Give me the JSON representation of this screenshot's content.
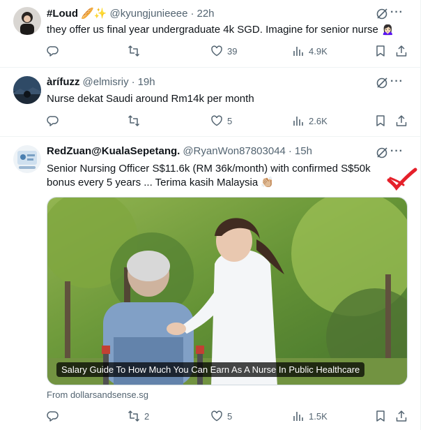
{
  "colors": {
    "text": "#0f1419",
    "secondary": "#536471",
    "border": "#eff3f4",
    "accent_mark": "#e5202a"
  },
  "tweets": [
    {
      "display_name": "#Loud 🥖✨",
      "handle": "@kyungjunieeee",
      "time": "22h",
      "text": "they offer us final year undergraduate 4k SGD. Imagine for senior nurse 🙍🏻‍♀️",
      "replies": "",
      "reposts": "",
      "likes": "39",
      "views": "4.9K"
    },
    {
      "display_name": "àrífuzz",
      "handle": "@elmisriy",
      "time": "19h",
      "text": "Nurse dekat Saudi around Rm14k per month",
      "replies": "",
      "reposts": "",
      "likes": "5",
      "views": "2.6K"
    },
    {
      "display_name": "RedZuan@KualaSepetang.",
      "handle": "@RyanWon87803044",
      "time": "15h",
      "text": "Senior Nursing Officer S$11.6k (RM 36k/month) with confirmed S$50k bonus every 5 years ... Terima kasih Malaysia 👏🏼",
      "card_caption": "Salary Guide To How Much You Can Earn As A Nurse In Public Healthcare",
      "card_source": "From dollarsandsense.sg",
      "replies": "",
      "reposts": "2",
      "likes": "5",
      "views": "1.5K"
    }
  ],
  "icons": {
    "reply": "reply-icon",
    "repost": "repost-icon",
    "like": "heart-icon",
    "views": "views-icon",
    "bookmark": "bookmark-icon",
    "share": "share-icon",
    "grok": "grok-icon",
    "more": "more-icon"
  },
  "more_label": "···",
  "dot": "·"
}
